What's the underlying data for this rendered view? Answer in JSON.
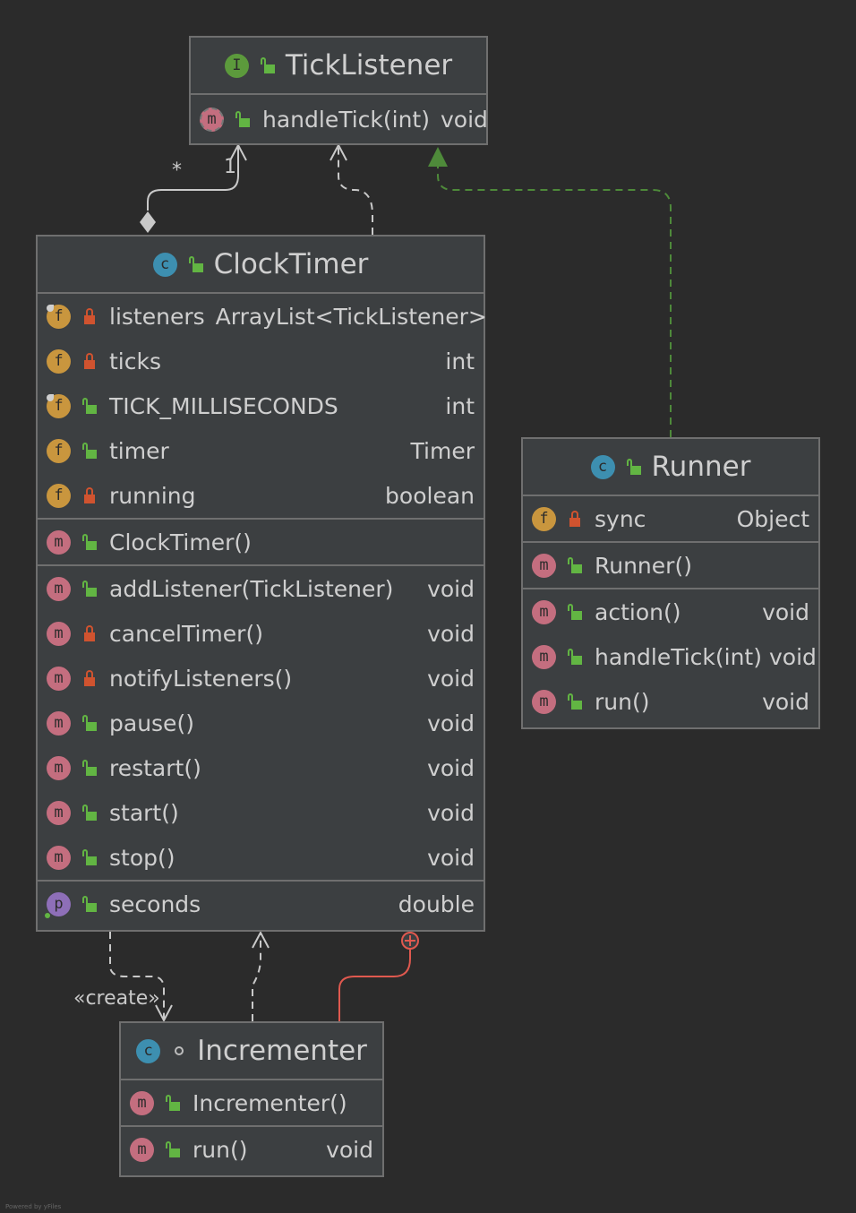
{
  "diagram": {
    "colors": {
      "background": "#2b2b2b",
      "node_fill": "#3c3f41",
      "node_border": "#6f6f6f",
      "edge": "#c9c9c9",
      "realization": "#4e8a3a",
      "inner_class": "#e0594f"
    },
    "classes": {
      "tick_listener": {
        "title": "TickListener",
        "kind": "interface",
        "methods": [
          {
            "name": "handleTick(int)",
            "type": "void",
            "visibility": "public",
            "abstract": true
          }
        ]
      },
      "clock_timer": {
        "title": "ClockTimer",
        "kind": "class",
        "fields": [
          {
            "name": "listeners",
            "type": "ArrayList<TickListener>",
            "visibility": "private",
            "final": true
          },
          {
            "name": "ticks",
            "type": "int",
            "visibility": "private"
          },
          {
            "name": "TICK_MILLISECONDS",
            "type": "int",
            "visibility": "public",
            "final": true
          },
          {
            "name": "timer",
            "type": "Timer",
            "visibility": "public"
          },
          {
            "name": "running",
            "type": "boolean",
            "visibility": "private"
          }
        ],
        "constructors": [
          {
            "name": "ClockTimer()"
          }
        ],
        "methods": [
          {
            "name": "addListener(TickListener)",
            "type": "void",
            "visibility": "public"
          },
          {
            "name": "cancelTimer()",
            "type": "void",
            "visibility": "private"
          },
          {
            "name": "notifyListeners()",
            "type": "void",
            "visibility": "private"
          },
          {
            "name": "pause()",
            "type": "void",
            "visibility": "public"
          },
          {
            "name": "restart()",
            "type": "void",
            "visibility": "public"
          },
          {
            "name": "start()",
            "type": "void",
            "visibility": "public"
          },
          {
            "name": "stop()",
            "type": "void",
            "visibility": "public"
          }
        ],
        "properties": [
          {
            "name": "seconds",
            "type": "double",
            "visibility": "public"
          }
        ]
      },
      "runner": {
        "title": "Runner",
        "kind": "class",
        "fields": [
          {
            "name": "sync",
            "type": "Object",
            "visibility": "private"
          }
        ],
        "constructors": [
          {
            "name": "Runner()"
          }
        ],
        "methods": [
          {
            "name": "action()",
            "type": "void",
            "visibility": "public"
          },
          {
            "name": "handleTick(int)",
            "type": "void",
            "visibility": "public"
          },
          {
            "name": "run()",
            "type": "void",
            "visibility": "public"
          }
        ]
      },
      "incrementer": {
        "title": "Incrementer",
        "kind": "class",
        "constructors": [
          {
            "name": "Incrementer()"
          }
        ],
        "methods": [
          {
            "name": "run()",
            "type": "void",
            "visibility": "public"
          }
        ]
      }
    },
    "edges": {
      "aggregation_source_multiplicity": "*",
      "aggregation_target_multiplicity": "1",
      "create_label": "«create»"
    },
    "icons": {
      "interface": "I",
      "class": "c",
      "field": "f",
      "method": "m",
      "property": "p",
      "public": "unlocked-green-icon",
      "private": "lock-orange-icon",
      "package": "circle-icon"
    },
    "credit": "Powered by yFiles"
  }
}
